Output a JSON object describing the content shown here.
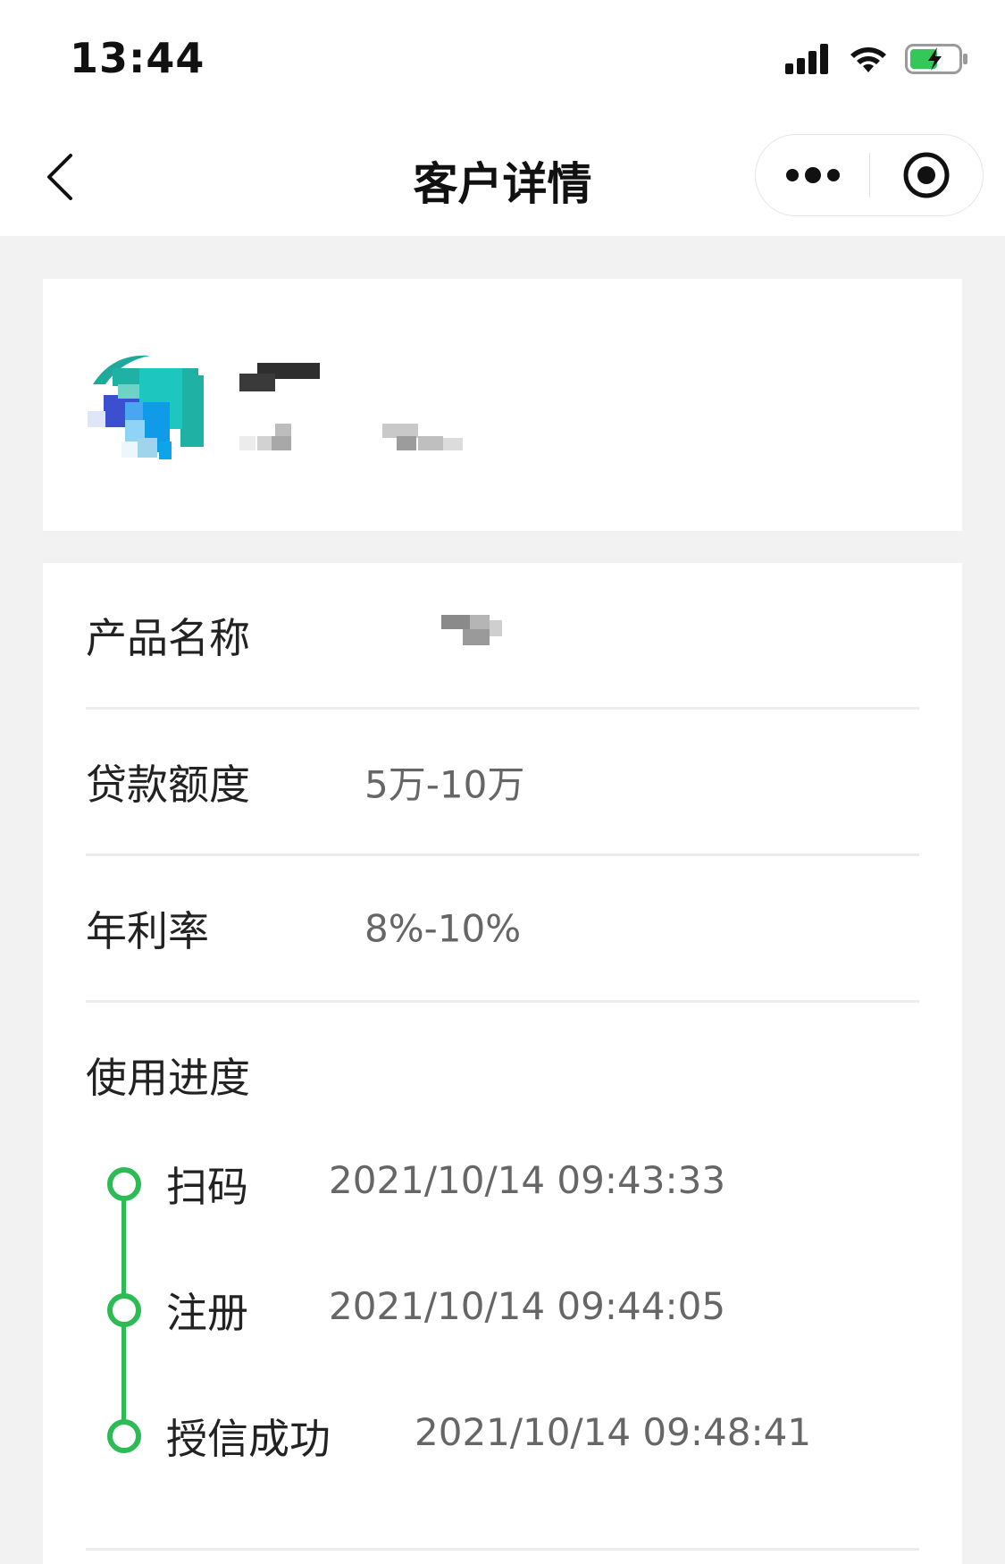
{
  "status_bar": {
    "time": "13:44",
    "signal_icon": "cellular-signal-icon",
    "wifi_icon": "wifi-icon",
    "battery_icon": "battery-charging-icon",
    "battery_color": "#34c759"
  },
  "nav": {
    "title": "客户详情",
    "back_icon": "chevron-left-icon",
    "more_icon": "more-dots-icon",
    "close_icon": "target-close-icon"
  },
  "profile": {
    "avatar": "customer-avatar",
    "name": "",
    "subtitle": ""
  },
  "details": {
    "rows": [
      {
        "label": "产品名称",
        "value": ""
      },
      {
        "label": "贷款额度",
        "value": "5万-10万"
      },
      {
        "label": "年利率",
        "value": "8%-10%"
      }
    ],
    "progress_title": "使用进度",
    "timeline": [
      {
        "label": "扫码",
        "time": "2021/10/14 09:43:33"
      },
      {
        "label": "注册",
        "time": "2021/10/14 09:44:05"
      },
      {
        "label": "授信成功",
        "time": "2021/10/14 09:48:41"
      }
    ]
  },
  "colors": {
    "accent_green": "#2dbb55",
    "background": "#f2f2f2",
    "card": "#ffffff"
  }
}
